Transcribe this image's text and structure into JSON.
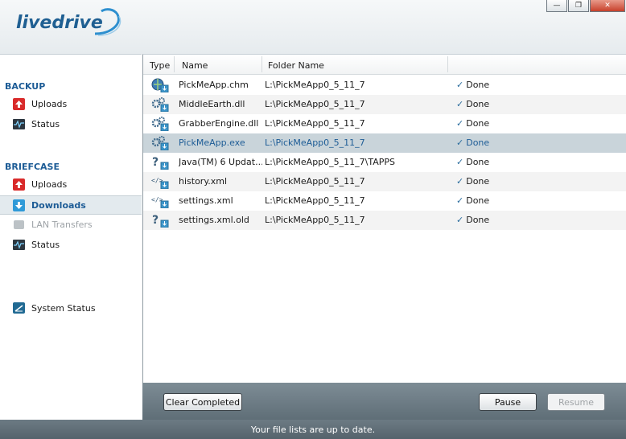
{
  "app": {
    "logo_text": "livedrive"
  },
  "window_controls": {
    "minimize": "—",
    "restore": "❐",
    "close": "✕"
  },
  "sidebar": {
    "backup": {
      "title": "BACKUP",
      "items": [
        {
          "label": "Uploads",
          "icon": "upload-icon"
        },
        {
          "label": "Status",
          "icon": "status-icon"
        }
      ]
    },
    "briefcase": {
      "title": "BRIEFCASE",
      "items": [
        {
          "label": "Uploads",
          "icon": "upload-icon"
        },
        {
          "label": "Downloads",
          "icon": "download-icon",
          "selected": true
        },
        {
          "label": "LAN Transfers",
          "icon": "lan-icon",
          "disabled": true
        },
        {
          "label": "Status",
          "icon": "status-icon"
        }
      ]
    },
    "system_status": {
      "label": "System Status",
      "icon": "system-status-icon"
    }
  },
  "table": {
    "columns": {
      "type": "Type",
      "name": "Name",
      "folder": "Folder Name"
    },
    "rows": [
      {
        "icon": "help-file-icon",
        "name": "PickMeApp.chm",
        "folder": "L:\\PickMeApp0_5_11_7",
        "status": "Done"
      },
      {
        "icon": "gear-file-icon",
        "name": "MiddleEarth.dll",
        "folder": "L:\\PickMeApp0_5_11_7",
        "status": "Done"
      },
      {
        "icon": "gear-file-icon",
        "name": "GrabberEngine.dll",
        "folder": "L:\\PickMeApp0_5_11_7",
        "status": "Done"
      },
      {
        "icon": "gear-file-icon",
        "name": "PickMeApp.exe",
        "folder": "L:\\PickMeApp0_5_11_7",
        "status": "Done",
        "selected": true
      },
      {
        "icon": "unknown-file-icon",
        "name": "Java(TM) 6 Updat...",
        "folder": "L:\\PickMeApp0_5_11_7\\TAPPS",
        "status": "Done"
      },
      {
        "icon": "xml-file-icon",
        "name": "history.xml",
        "folder": "L:\\PickMeApp0_5_11_7",
        "status": "Done"
      },
      {
        "icon": "xml-file-icon",
        "name": "settings.xml",
        "folder": "L:\\PickMeApp0_5_11_7",
        "status": "Done"
      },
      {
        "icon": "unknown-file-icon",
        "name": "settings.xml.old",
        "folder": "L:\\PickMeApp0_5_11_7",
        "status": "Done"
      }
    ]
  },
  "buttons": {
    "clear": "Clear Completed",
    "pause": "Pause",
    "resume": "Resume"
  },
  "status_bar": {
    "text": "Your file lists are up to date."
  },
  "colors": {
    "brand": "#1f5f92",
    "selected_row": "#c9d4da",
    "bar": "#5f6e77"
  }
}
